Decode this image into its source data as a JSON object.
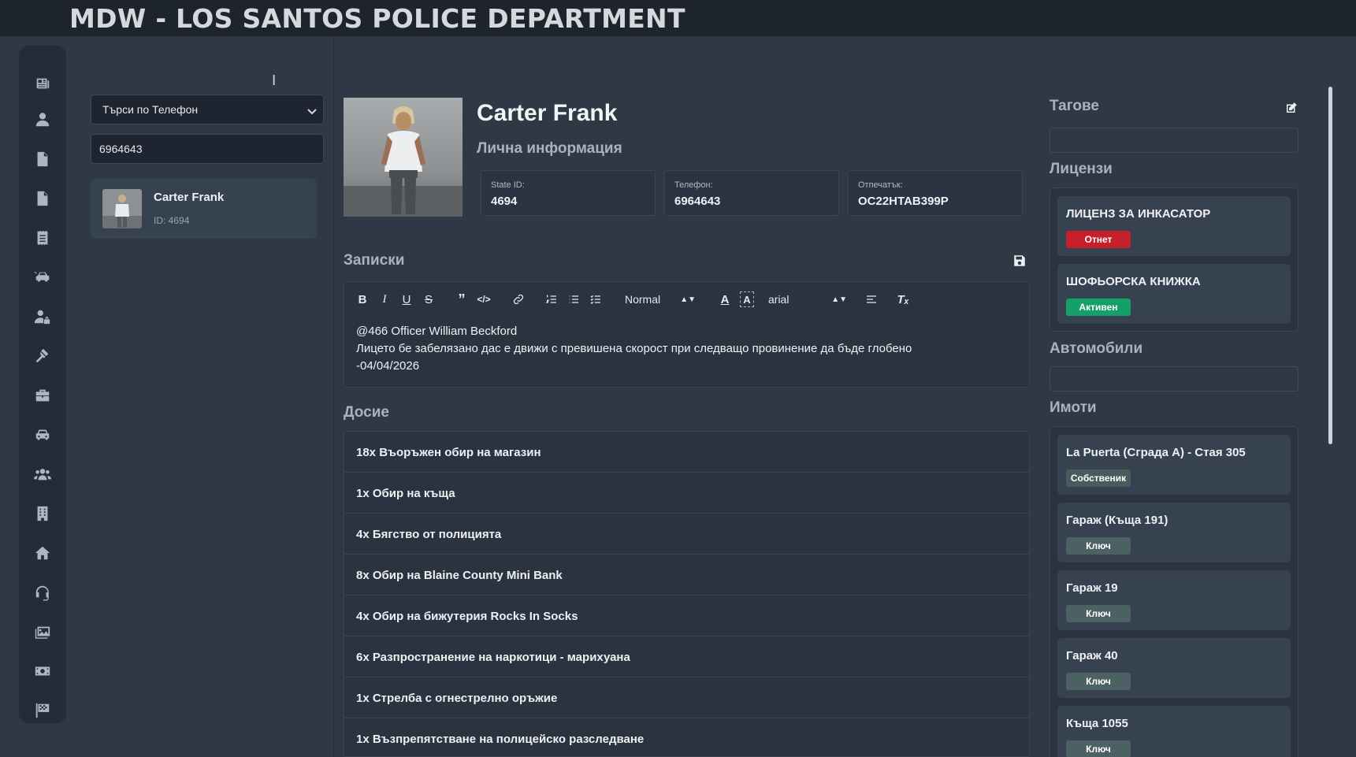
{
  "app": {
    "title": "MDW - LOS SANTOS POLICE DEPARTMENT"
  },
  "sidebar": {
    "icons": [
      "newspaper-icon",
      "user-icon",
      "file-icon",
      "file-alt-icon",
      "receipt-icon",
      "car-crash-icon",
      "user-lock-icon",
      "gavel-icon",
      "briefcase-icon",
      "car-icon",
      "users-icon",
      "building-icon",
      "home-icon",
      "headset-icon",
      "images-icon",
      "money-icon",
      "flag-checkered-icon"
    ]
  },
  "search": {
    "filter_label": "Търси по Телефон",
    "query": "6964643",
    "results": [
      {
        "name": "Carter Frank",
        "id_label": "ID: 4694"
      }
    ]
  },
  "profile": {
    "name": "Carter Frank",
    "subtitle": "Лична информация",
    "fields": [
      {
        "label": "State ID:",
        "value": "4694"
      },
      {
        "label": "Телефон:",
        "value": "6964643"
      },
      {
        "label": "Отпечатък:",
        "value": "OC22HTAB399P"
      }
    ]
  },
  "notes": {
    "title": "Записки",
    "toolbar": {
      "header_select": "Normal",
      "font_select": "arial"
    },
    "lines": [
      "@466 Officer William Beckford",
      "Лицето бе забелязано дас е движи с превишена скорост при следващо провинение да бъде глобено",
      "-04/04/2026"
    ]
  },
  "dossier": {
    "title": "Досие",
    "items": [
      "18x Въоръжен обир на магазин",
      "1x Обир на къща",
      "4x Бягство от полицията",
      "8x Обир на Blaine County Mini Bank",
      "4x Обир на бижутерия Rocks In Socks",
      "6x Разпространение на наркотици - марихуана",
      "1x Стрелба с огнестрелно оръжие",
      "1x Възпрепятстване на полицейско разследване"
    ]
  },
  "right": {
    "tags_title": "Тагове",
    "licenses_title": "Лицензи",
    "licenses": [
      {
        "name": "ЛИЦЕНЗ ЗА ИНКАСАТОР",
        "status": "Отнет",
        "color": "#c8202a"
      },
      {
        "name": "ШОФЬОРСКА КНИЖКА",
        "status": "Активен",
        "color": "#159f6a"
      }
    ],
    "vehicles_title": "Автомобили",
    "properties_title": "Имоти",
    "properties": [
      {
        "name": "La Puerta (Сграда A) - Стая 305",
        "badge": "Собственик"
      },
      {
        "name": "Гараж (Къща 191)",
        "badge": "Ключ"
      },
      {
        "name": "Гараж 19",
        "badge": "Ключ"
      },
      {
        "name": "Гараж 40",
        "badge": "Ключ"
      },
      {
        "name": "Къща 1055",
        "badge": "Ключ"
      }
    ]
  },
  "colors": {
    "background": "#2f3946",
    "topbar": "#1e242c",
    "panel": "#2a333f",
    "card": "#374250",
    "badge_revoked": "#c8202a",
    "badge_active": "#159f6a",
    "badge_key": "#4b6163"
  }
}
